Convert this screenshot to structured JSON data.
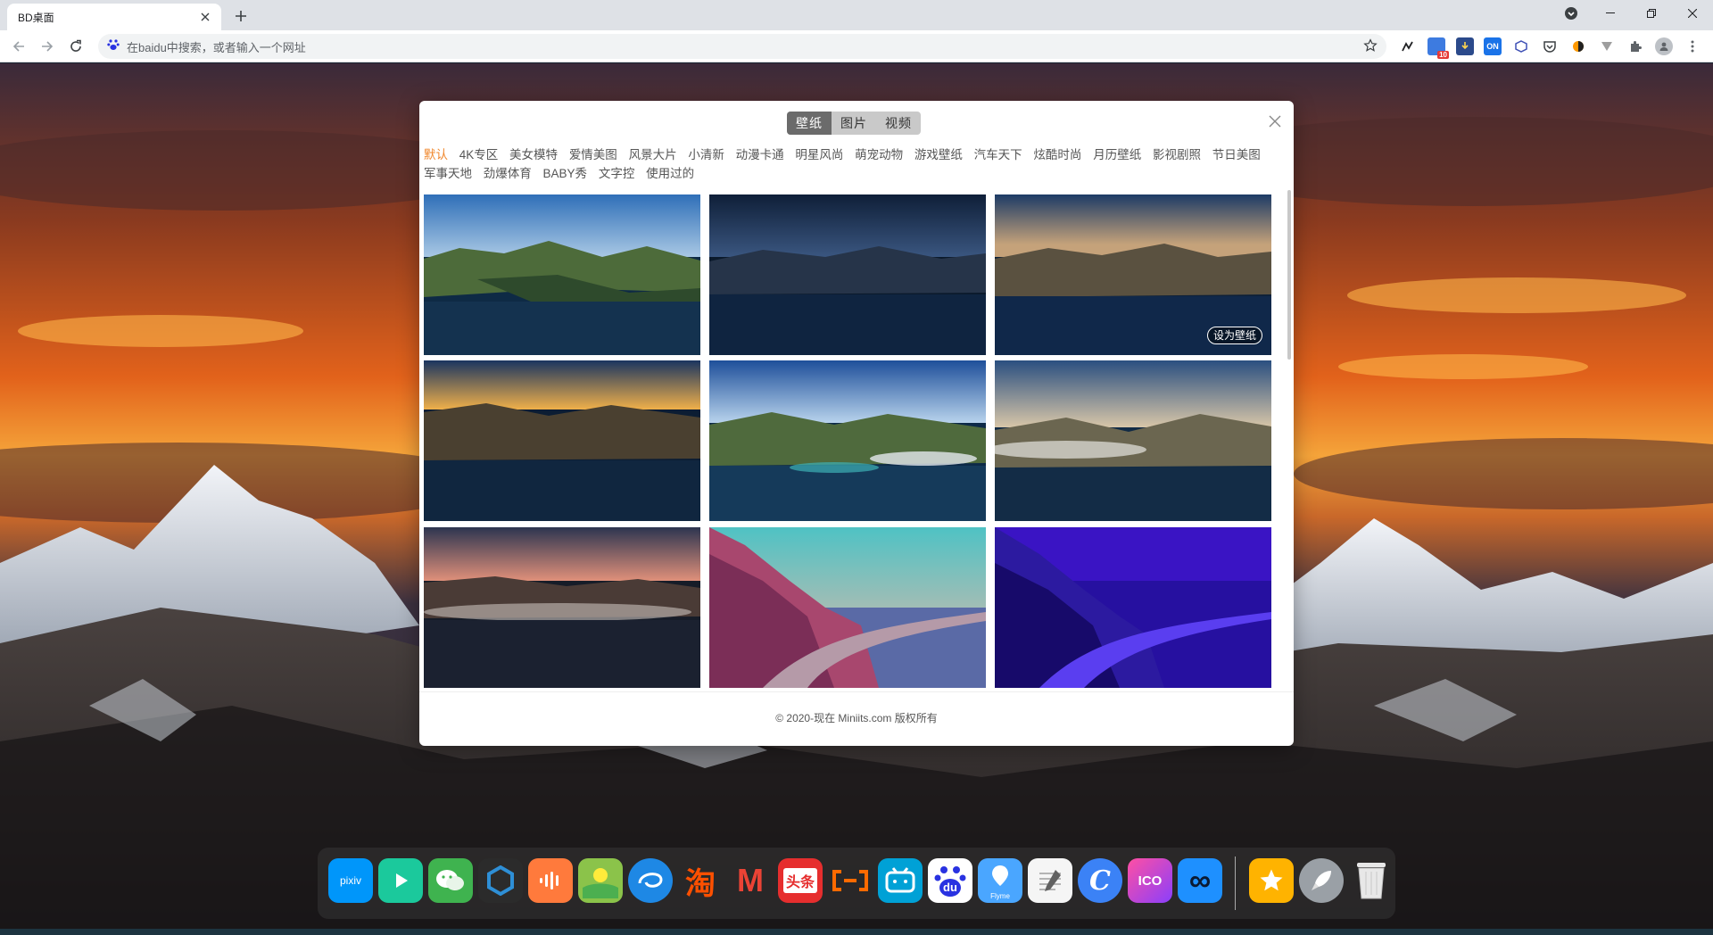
{
  "browser": {
    "tab_title": "BD桌面",
    "omnibox_placeholder": "在baidu中搜索，或者输入一个网址",
    "extensions": [
      {
        "icon": "pen-icon"
      },
      {
        "icon": "tasks-icon",
        "badge": "10"
      },
      {
        "icon": "download-icon"
      },
      {
        "icon": "translate-toggle-icon",
        "badge": "ON"
      },
      {
        "icon": "cube-icon"
      },
      {
        "icon": "pocket-icon"
      },
      {
        "icon": "color-wheel-icon"
      },
      {
        "icon": "vue-devtools-icon"
      },
      {
        "icon": "puzzle-icon"
      },
      {
        "icon": "profile-icon"
      }
    ]
  },
  "modal": {
    "tabs": [
      {
        "label": "壁纸",
        "active": true
      },
      {
        "label": "图片",
        "active": false
      },
      {
        "label": "视频",
        "active": false
      }
    ],
    "categories": [
      {
        "label": "默认",
        "active": true
      },
      {
        "label": "4K专区"
      },
      {
        "label": "美女模特"
      },
      {
        "label": "爱情美图"
      },
      {
        "label": "风景大片"
      },
      {
        "label": "小清新"
      },
      {
        "label": "动漫卡通"
      },
      {
        "label": "明星风尚"
      },
      {
        "label": "萌宠动物"
      },
      {
        "label": "游戏壁纸"
      },
      {
        "label": "汽车天下"
      },
      {
        "label": "炫酷时尚"
      },
      {
        "label": "月历壁纸"
      },
      {
        "label": "影视剧照"
      },
      {
        "label": "节日美图"
      },
      {
        "label": "军事天地"
      },
      {
        "label": "劲爆体育"
      },
      {
        "label": "BABY秀"
      },
      {
        "label": "文字控"
      },
      {
        "label": "使用过的"
      }
    ],
    "set_wallpaper_label": "设为壁纸",
    "footer": "© 2020-现在 Miniits.com 版权所有"
  },
  "dock": {
    "apps": [
      {
        "name": "pixiv",
        "label": "pixiv",
        "color": "#0096fa"
      },
      {
        "name": "video-player",
        "color": "#1bc99c"
      },
      {
        "name": "wechat",
        "color": "#3fb34f"
      },
      {
        "name": "hexagon-app",
        "color": "#2e8fd6"
      },
      {
        "name": "podcast",
        "color": "#ff7a3c"
      },
      {
        "name": "weather",
        "color": "#f4b400"
      },
      {
        "name": "weibo-like",
        "color": "#1e88e5"
      },
      {
        "name": "taobao",
        "label": "淘",
        "color": "#ff5000"
      },
      {
        "name": "gmail",
        "label": "M",
        "color": "#ffffff"
      },
      {
        "name": "toutiao",
        "label": "头条",
        "color": "#e62e2e"
      },
      {
        "name": "aliyun",
        "color": "#ff6a00"
      },
      {
        "name": "bilibili",
        "color": "#00a1d6"
      },
      {
        "name": "baidu",
        "label": "du",
        "color": "#2932e1"
      },
      {
        "name": "flyme",
        "label": "Flyme",
        "color": "#4aa6ff"
      },
      {
        "name": "notes",
        "color": "#f5f5f5"
      },
      {
        "name": "c-app",
        "label": "C",
        "color": "#3b82f6"
      },
      {
        "name": "icourse",
        "label": "ICO",
        "color": "#8a3ffc"
      },
      {
        "name": "infinity",
        "label": "∞",
        "color": "#1e90ff"
      },
      {
        "name": "favorites",
        "color": "#ffb300"
      },
      {
        "name": "launchpad",
        "color": "#9aa0a6"
      },
      {
        "name": "trash",
        "color": "#e8e8e8"
      }
    ]
  }
}
